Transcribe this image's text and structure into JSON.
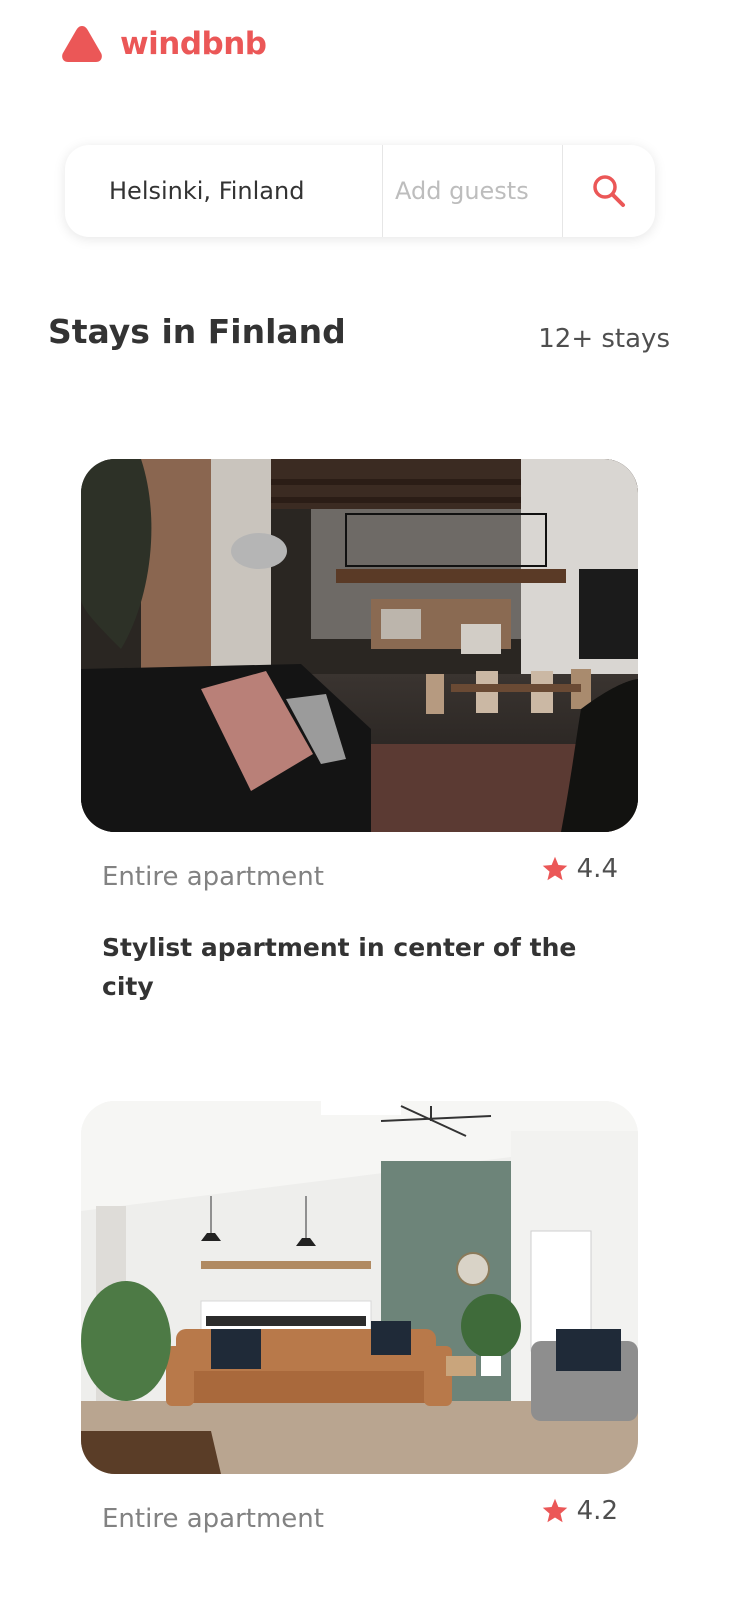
{
  "brand": {
    "name": "windbnb",
    "accent_color": "#EB5757"
  },
  "search": {
    "location_value": "Helsinki, Finland",
    "guests_placeholder": "Add guests",
    "icon": "search-icon"
  },
  "section": {
    "title": "Stays in Finland",
    "count": "12+ stays"
  },
  "stays": [
    {
      "type": "Entire apartment",
      "rating": "4.4",
      "title": "Stylist apartment in center of the city",
      "photo": "loft-living-room-photo"
    },
    {
      "type": "Entire apartment",
      "rating": "4.2",
      "title": "",
      "photo": "bright-living-room-photo"
    }
  ]
}
